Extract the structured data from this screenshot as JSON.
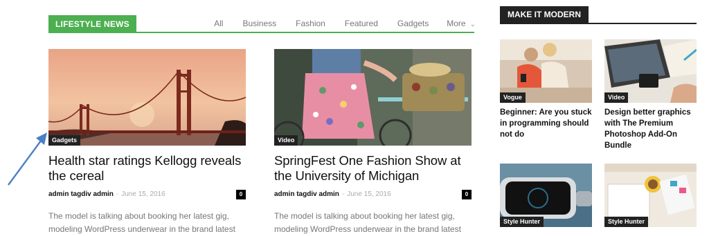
{
  "block": {
    "title": "LIFESTYLE NEWS",
    "filters": [
      "All",
      "Business",
      "Fashion",
      "Featured",
      "Gadgets"
    ],
    "more_label": "More",
    "accent": "#4caf50"
  },
  "articles": [
    {
      "category": "Gadgets",
      "title": "Health star ratings Kellogg reveals the cereal",
      "author": "admin tagdiv admin",
      "date": "June 15, 2016",
      "comments": "0",
      "excerpt": "The model is talking about booking her latest gig, modeling WordPress underwear in the brand latest"
    },
    {
      "category": "Video",
      "title": "SpringFest One Fashion Show at the University of Michigan",
      "author": "admin tagdiv admin",
      "date": "June 15, 2016",
      "comments": "0",
      "excerpt": "The model is talking about booking her latest gig, modeling WordPress underwear in the brand latest"
    }
  ],
  "sidebar": {
    "title": "MAKE IT MODERN",
    "items": [
      {
        "category": "Vogue",
        "title": "Beginner: Are you stuck in programming should not do"
      },
      {
        "category": "Video",
        "title": "Design better graphics with The Premium Photoshop Add-On Bundle"
      },
      {
        "category": "Style Hunter",
        "title": ""
      },
      {
        "category": "Style Hunter",
        "title": ""
      }
    ]
  },
  "separator": "-",
  "icons": {
    "more_chevron": "chevron-down-icon",
    "annotation": "arrow-icon"
  }
}
